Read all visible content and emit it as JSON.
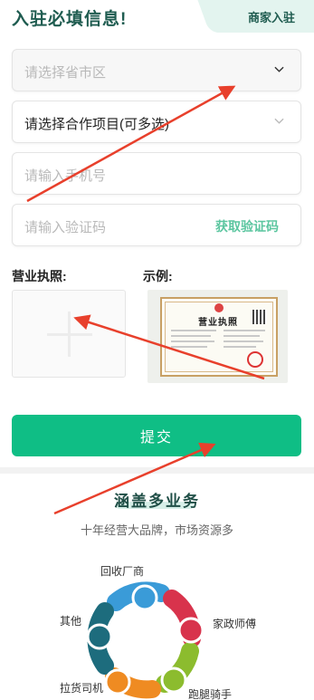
{
  "header": {
    "title": "入驻必填信息!",
    "merchant_tab": "商家入驻"
  },
  "form": {
    "region_placeholder": "请选择省市区",
    "project_value": "请选择合作项目(可多选)",
    "phone_placeholder": "请输入手机号",
    "code_placeholder": "请输入验证码",
    "get_code": "获取验证码",
    "license_label": "营业执照:",
    "example_label": "示例:",
    "submit": "提交"
  },
  "license_example": {
    "title": "营业执照"
  },
  "business": {
    "title": "涵盖多业务",
    "subtitle": "十年经营大品牌，市场资源多",
    "categories": [
      "回收厂商",
      "家政师傅",
      "跑腿骑手",
      "拉货司机",
      "其他"
    ],
    "colors": [
      "#3a9bd8",
      "#d8334c",
      "#8cbc2e",
      "#ef8b22",
      "#1d6c7d"
    ]
  },
  "annotation_color": "#e8402c"
}
